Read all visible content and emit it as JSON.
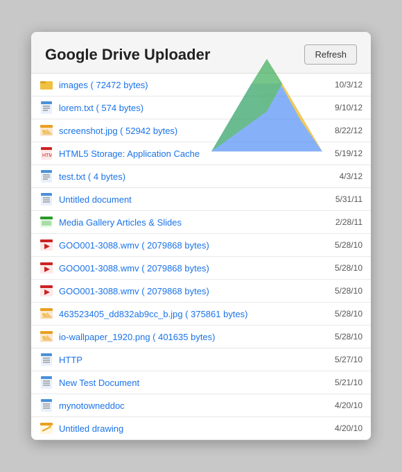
{
  "header": {
    "title": "Google Drive Uploader",
    "refresh_label": "Refresh"
  },
  "items": [
    {
      "id": 1,
      "icon_type": "folder",
      "name": "images ( 72472 bytes)",
      "date": "10/3/12",
      "link": true
    },
    {
      "id": 2,
      "icon_type": "txt",
      "name": "lorem.txt ( 574 bytes)",
      "date": "9/10/12",
      "link": true
    },
    {
      "id": 3,
      "icon_type": "img",
      "name": "screenshot.jpg ( 52942 bytes)",
      "date": "8/22/12",
      "link": true
    },
    {
      "id": 4,
      "icon_type": "html",
      "name": "HTML5 Storage: Application Cache",
      "date": "5/19/12",
      "link": true
    },
    {
      "id": 5,
      "icon_type": "txt",
      "name": "test.txt ( 4 bytes)",
      "date": "4/3/12",
      "link": true
    },
    {
      "id": 6,
      "icon_type": "doc",
      "name": "Untitled document",
      "date": "5/31/11",
      "link": true
    },
    {
      "id": 7,
      "icon_type": "slides",
      "name": "Media Gallery Articles & Slides",
      "date": "2/28/11",
      "link": true
    },
    {
      "id": 8,
      "icon_type": "wmv",
      "name": "GOO001-3088.wmv ( 2079868 bytes)",
      "date": "5/28/10",
      "link": true
    },
    {
      "id": 9,
      "icon_type": "wmv",
      "name": "GOO001-3088.wmv ( 2079868 bytes)",
      "date": "5/28/10",
      "link": true
    },
    {
      "id": 10,
      "icon_type": "wmv",
      "name": "GOO001-3088.wmv ( 2079868 bytes)",
      "date": "5/28/10",
      "link": true
    },
    {
      "id": 11,
      "icon_type": "img",
      "name": "463523405_dd832ab9cc_b.jpg ( 375861 bytes)",
      "date": "5/28/10",
      "link": true
    },
    {
      "id": 12,
      "icon_type": "img",
      "name": "io-wallpaper_1920.png ( 401635 bytes)",
      "date": "5/28/10",
      "link": true
    },
    {
      "id": 13,
      "icon_type": "doc",
      "name": "HTTP",
      "date": "5/27/10",
      "link": true
    },
    {
      "id": 14,
      "icon_type": "doc",
      "name": "New Test Document",
      "date": "5/21/10",
      "link": true
    },
    {
      "id": 15,
      "icon_type": "doc",
      "name": "mynotowneddoc",
      "date": "4/20/10",
      "link": true
    },
    {
      "id": 16,
      "icon_type": "drawing",
      "name": "Untitled drawing",
      "date": "4/20/10",
      "link": true
    }
  ]
}
